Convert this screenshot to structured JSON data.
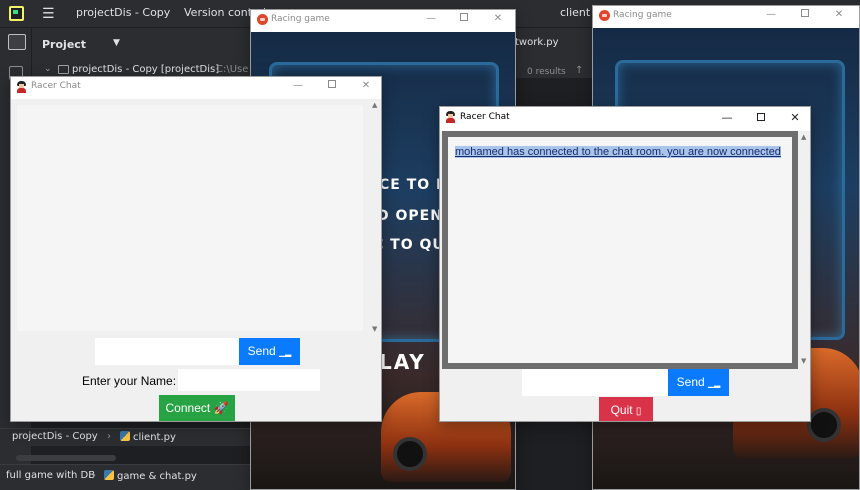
{
  "ide": {
    "project_title": "projectDis - Copy",
    "version_control": "Version control",
    "client_tab": "client",
    "project_label": "Project",
    "tree_item": "projectDis - Copy [projectDis]",
    "tree_path": "C:\\Use",
    "right_file": "twork.py",
    "results": "0 results",
    "breadcrumb1": {
      "project": "projectDis - Copy",
      "file": "client.py"
    },
    "breadcrumb2": {
      "folder": "full game with DB",
      "file": "game & chat.py"
    }
  },
  "game_windows": [
    {
      "title": "Racing game",
      "lines": [
        "CE TO P",
        "D OPEN C",
        "C TO QU"
      ],
      "play": "LAY"
    },
    {
      "title": "Racing game"
    }
  ],
  "chat_left": {
    "title": "Racer Chat",
    "send_label": "Send",
    "name_label": "Enter your Name:",
    "connect_label": "Connect",
    "message_value": "",
    "name_value": ""
  },
  "chat_right": {
    "title": "Racer Chat",
    "messages": [
      "mohamed has connected to the chat room. you are now connected"
    ],
    "send_label": "Send",
    "quit_label": "Quit",
    "message_value": ""
  },
  "colors": {
    "send_button": "#0a7bff",
    "connect_button": "#27a344",
    "quit_button": "#d9334a",
    "ide_bg": "#1e1f22"
  }
}
